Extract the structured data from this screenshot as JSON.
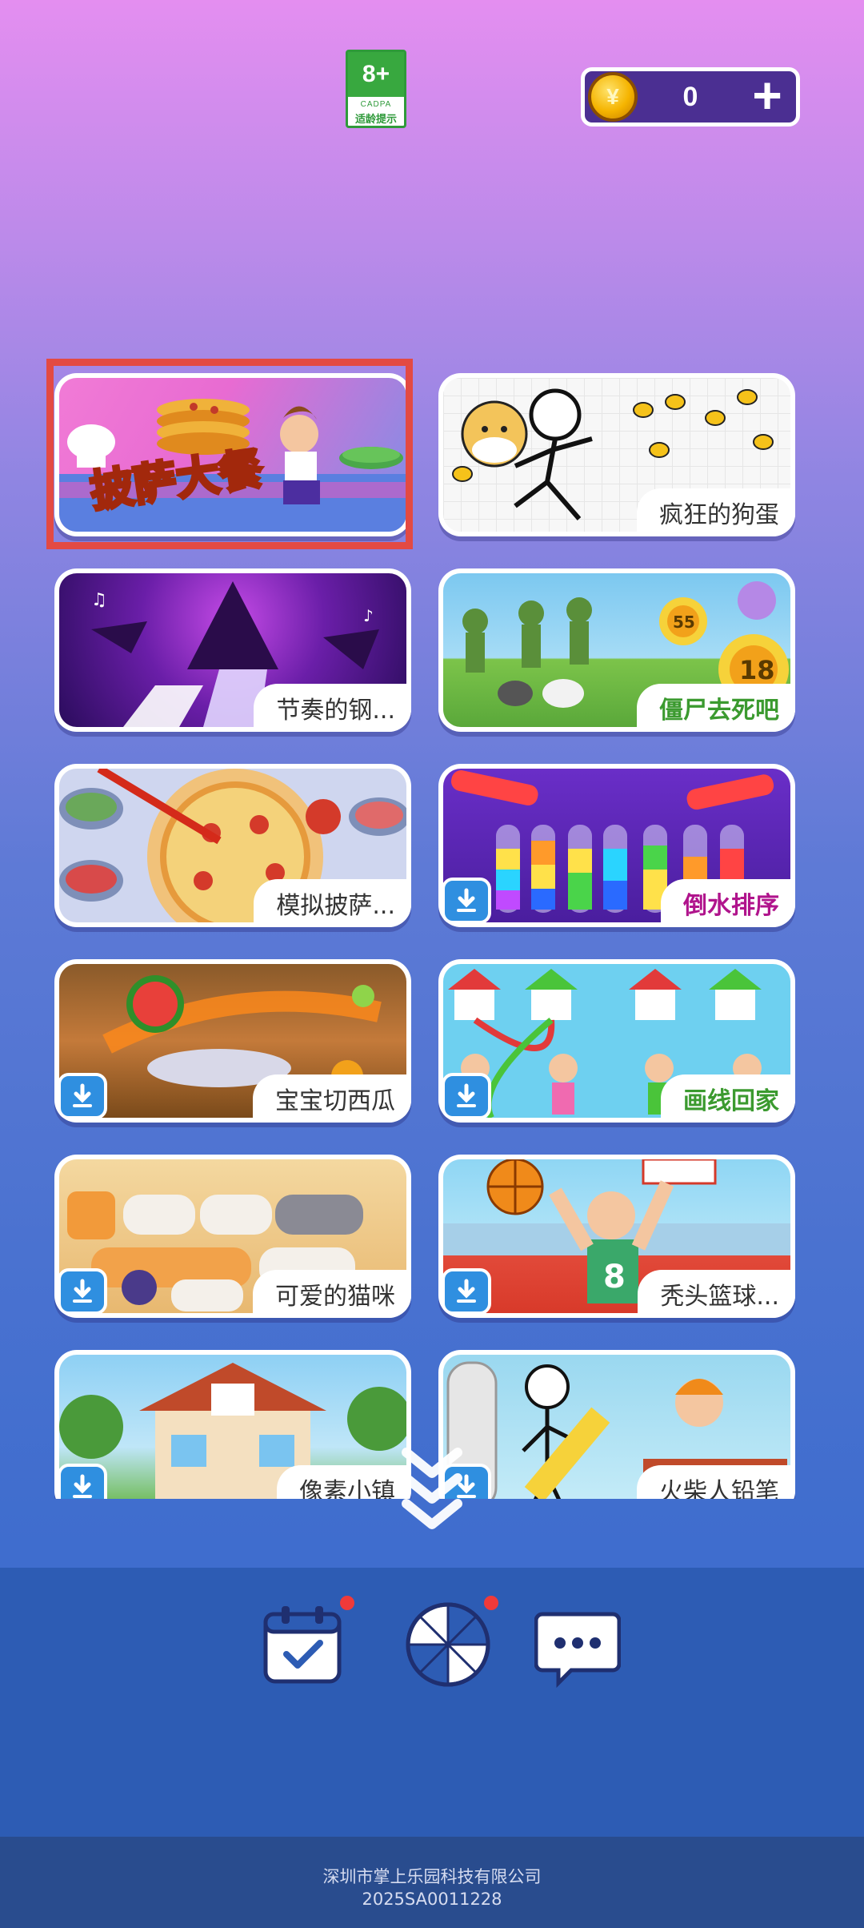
{
  "age_badge": {
    "rating": "8+",
    "org": "CADPA",
    "tip": "适龄提示"
  },
  "coins": {
    "value": "0",
    "plus": "+",
    "icon": "coin-icon"
  },
  "games": [
    {
      "label": "披萨大餐",
      "style": "",
      "download": false,
      "selected": true
    },
    {
      "label": "疯狂的狗蛋",
      "style": "",
      "download": false
    },
    {
      "label": "节奏的钢...",
      "style": "",
      "download": false
    },
    {
      "label": "僵尸去死吧",
      "style": "green",
      "download": false
    },
    {
      "label": "模拟披萨...",
      "style": "",
      "download": false
    },
    {
      "label": "倒水排序",
      "style": "purple",
      "download": true
    },
    {
      "label": "宝宝切西瓜",
      "style": "",
      "download": true
    },
    {
      "label": "画线回家",
      "style": "green",
      "download": true
    },
    {
      "label": "可爱的猫咪",
      "style": "",
      "download": true
    },
    {
      "label": "秃头篮球...",
      "style": "",
      "download": true
    },
    {
      "label": "像素小镇",
      "style": "",
      "download": true
    },
    {
      "label": "火柴人铅笔",
      "style": "",
      "download": true
    }
  ],
  "art_text": {
    "pizza_title": "披萨大餐",
    "zombie_num_a": "55",
    "zombie_num_b": "18",
    "jersey": "8"
  },
  "bottom_bar": {
    "icons": [
      "calendar-check-icon",
      "wheel-icon",
      "chat-more-icon"
    ]
  },
  "footer": {
    "company": "深圳市掌上乐园科技有限公司",
    "code": "2025SA0011228"
  },
  "colors": {
    "accent_red": "#e34a43",
    "download_blue": "#2f8fe0",
    "coin_bg": "#4b2f92"
  }
}
